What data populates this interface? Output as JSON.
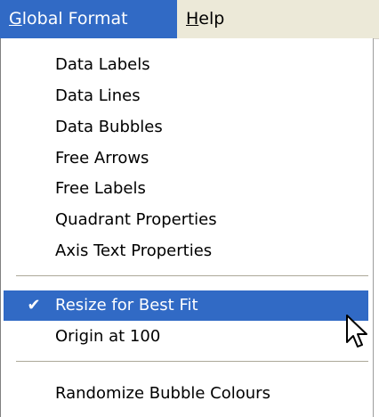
{
  "menubar": {
    "global_format": {
      "mnemonic": "G",
      "rest": "lobal Format"
    },
    "help": {
      "mnemonic": "H",
      "rest": "elp"
    }
  },
  "menu": {
    "items": [
      {
        "label": "Data Labels"
      },
      {
        "label": "Data Lines"
      },
      {
        "label": "Data Bubbles"
      },
      {
        "label": "Free Arrows"
      },
      {
        "label": "Free Labels"
      },
      {
        "label": "Quadrant Properties"
      },
      {
        "label": "Axis Text Properties"
      },
      {
        "label": "Resize for Best Fit",
        "checked": true,
        "highlighted": true
      },
      {
        "label": "Origin at 100"
      },
      {
        "label": "Randomize Bubble Colours"
      }
    ],
    "check_glyph": "✔"
  },
  "colors": {
    "highlight": "#316ac5",
    "menubar_bg": "#ece9d8"
  },
  "icons": {
    "cursor": "mouse-pointer-icon"
  }
}
